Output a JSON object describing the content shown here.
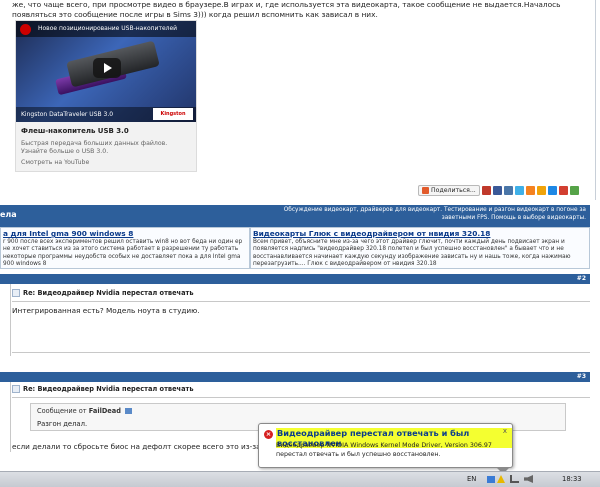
{
  "post1": {
    "text_line1": "же, что чаще всего, при просмотре видео в браузере.В играх и, где используется эта видеокарта, такое сообщение не выдается.Началось",
    "text_line2": "появляться это сообщение после игры в Sims 3))) когда решил вспомнить как зависал в них."
  },
  "ad": {
    "video_top_text": "Новое позиционирование USB-накопителей",
    "video_bottom_text": "Kingston DataTraveler USB 3.0",
    "brand": "Kingston",
    "title": "Флеш-накопитель USB 3.0",
    "description": "Быстрая передача больших данных файлов. Узнайте больше о USB 3.0.",
    "watch_label": "Смотреть на YouTube"
  },
  "share": {
    "label": "Поделиться..."
  },
  "related": {
    "header_left": "ела",
    "header_right": "Обсуждение видеокарт, драйверов для видеокарт. Тестирование и разгон видеокарт в погоне за заветными FPS. Помощь в выборе видеокарты.",
    "left_link": "а для Intel gma 900 windows 8",
    "left_text": "r 900 после всех экспериментов решил оставить win8 но вот беда ни один ер не хочет ставиться из за этого система работает в разрешении ту работать некоторые программы неудобств особых не доставляет пока а для Intel gma 900 windows 8",
    "right_link": "Видеокарты Глюк с видеодрайвером от нвидия 320.18",
    "right_text": "Всем привет, объясните мне из-за чего этот драйвер глючит, почти каждый день подвисает экран и появляется надпись \"видеодрайвер 320.18 полетел и был успешно восстановлен\" а бывает что и не восстанавливается начинает каждую секунду изображение зависать ну и нашь тоже, когда нажимаю перезагрузить.... Глюк с видеодрайвером от нвидия 320.18"
  },
  "post2": {
    "num": "#2",
    "title": "Re: Видеодрайвер Nvidia перестал отвечать",
    "body": "Интегрированная есть? Модель ноута в студию."
  },
  "post3": {
    "num": "#3",
    "title": "Re: Видеодрайвер Nvidia перестал отвечать",
    "quote_prefix": "Сообщение от",
    "quote_author": "FailDead",
    "quote_text": "Разгон делал.",
    "body": "если делали то сбросьте биос на дефолт скорее всего это из-за"
  },
  "balloon": {
    "title": "Видеодрайвер перестал отвечать и был восстановлен",
    "text": "Видеодрайвер NVIDIA Windows Kernel Mode Driver, Version 306.97  перестал отвечать и был успешно восстановлен.",
    "close_label": "x"
  },
  "taskbar": {
    "lang": "EN",
    "clock": "18:33"
  },
  "colors": {
    "forum_blue": "#2d5f9b",
    "link_blue": "#0a3a8a",
    "highlight_yellow": "#f4ff30",
    "error_red": "#d62020"
  }
}
